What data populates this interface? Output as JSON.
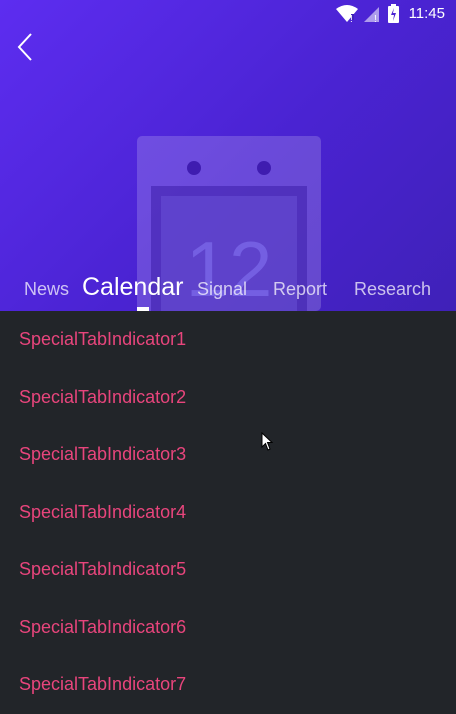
{
  "status_bar": {
    "time": "11:45"
  },
  "hero": {
    "calendar_day": "12"
  },
  "tabs": [
    {
      "label": "News",
      "active": false
    },
    {
      "label": "Calendar",
      "active": true
    },
    {
      "label": "Signal",
      "active": false
    },
    {
      "label": "Report",
      "active": false
    },
    {
      "label": "Research",
      "active": false
    }
  ],
  "list": {
    "items": [
      "SpecialTabIndicator1",
      "SpecialTabIndicator2",
      "SpecialTabIndicator3",
      "SpecialTabIndicator4",
      "SpecialTabIndicator5",
      "SpecialTabIndicator6",
      "SpecialTabIndicator7"
    ]
  },
  "colors": {
    "header_gradient_start": "#5d2df0",
    "header_gradient_end": "#3f21b8",
    "list_background": "#222529",
    "list_text": "#e8457c",
    "tab_active": "#ffffff"
  },
  "icons": [
    "wifi-icon",
    "signal-icon",
    "battery-icon",
    "back-arrow-icon",
    "calendar-icon",
    "mouse-cursor-icon"
  ]
}
